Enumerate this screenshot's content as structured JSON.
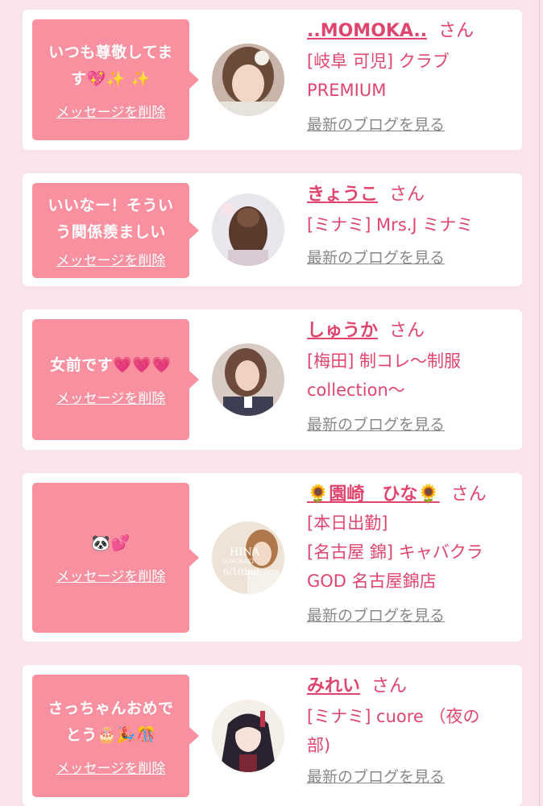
{
  "colors": {
    "accent": "#e0456e",
    "bubble": "#f8909f",
    "background": "#f9e4e9",
    "card": "#ffffff",
    "link_gray": "#888888"
  },
  "delete_label": "メッセージを削除",
  "blog_label": "最新のブログを見る",
  "san_label": "さん",
  "entries": [
    {
      "message_lines": [
        "いつも尊敬してま",
        "す💖✨ ✨"
      ],
      "name": "..MOMOKA..",
      "shop_lines": [
        "[岐阜 可児] クラブ",
        "PREMIUM"
      ],
      "avatar_icon": "avatar-photo"
    },
    {
      "message_lines": [
        "いいなー！そうい",
        "う関係羨ましい"
      ],
      "name": "きょうこ",
      "shop_lines": [
        "[ミナミ] Mrs.J ミナミ"
      ],
      "avatar_icon": "avatar-photo"
    },
    {
      "message_lines": [
        "女前です💗💗💗"
      ],
      "name": "しゅうか",
      "shop_lines": [
        "[梅田] 制コレ〜制服",
        "collection〜"
      ],
      "avatar_icon": "avatar-photo"
    },
    {
      "message_lines": [
        "🐼💕"
      ],
      "name": "🌻園崎　ひな🌻",
      "shop_lines": [
        "[本日出勤]",
        "[名古屋 錦] キャバクラ",
        "GOD 名古屋錦店"
      ],
      "avatar_icon": "avatar-photo",
      "avatar_text": [
        "HINA",
        "SONOSAKI",
        "6/1(thu)"
      ]
    },
    {
      "message_lines": [
        "さっちゃんおめで",
        "とう🎂🎉🎊"
      ],
      "name": "みれい",
      "shop_lines": [
        "[ミナミ] cuore （夜の",
        "部)"
      ],
      "avatar_icon": "avatar-illustration"
    }
  ]
}
